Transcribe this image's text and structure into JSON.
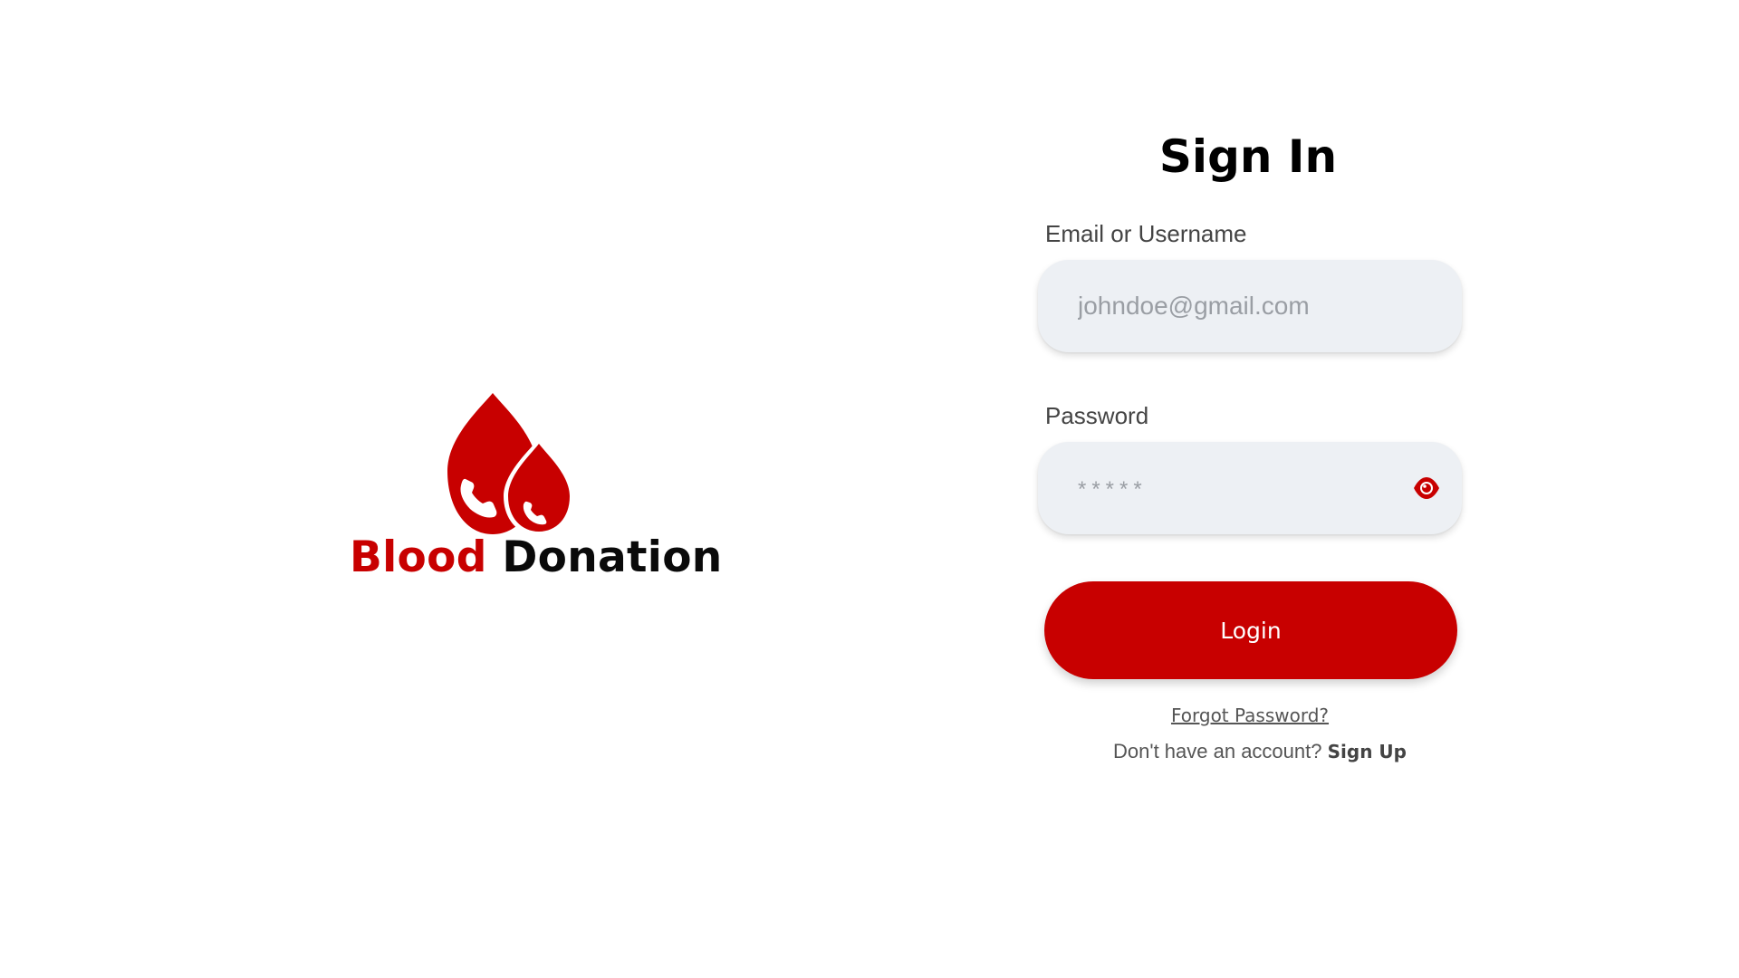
{
  "brand": {
    "word1": "Blood",
    "word2": "Donation",
    "accent_color": "#c80000",
    "logo_icon": "blood-drop-phone-icon"
  },
  "form": {
    "title": "Sign In",
    "email": {
      "label": "Email or Username",
      "placeholder": "johndoe@gmail.com",
      "value": ""
    },
    "password": {
      "label": "Password",
      "placeholder": "*****",
      "value": "",
      "toggle_icon": "eye-icon"
    },
    "login_label": "Login",
    "forgot_label": "Forgot Password?",
    "signup_prompt": "Don't have an account?",
    "signup_label": "Sign Up"
  }
}
